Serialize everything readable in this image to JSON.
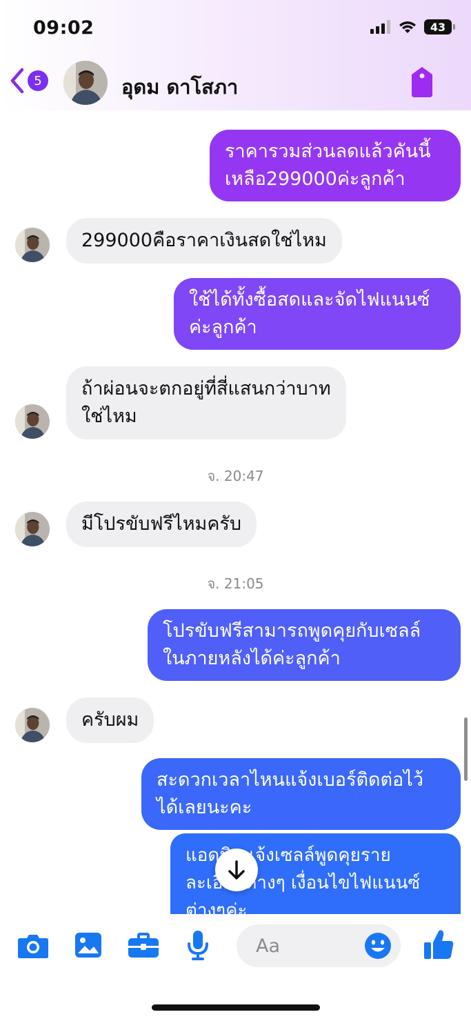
{
  "status_bar": {
    "time": "09:02",
    "battery": "43"
  },
  "header": {
    "unread_count": "5",
    "contact_name": "อุดม ดาโสภา"
  },
  "messages": [
    {
      "dir": "out",
      "text": "ราคารวมส่วนลดแล้วคันนี้\nเหลือ299000ค่ะลูกค้า"
    },
    {
      "dir": "in",
      "text": "299000คือราคาเงินสดใช่ไหม"
    },
    {
      "dir": "out",
      "text": "ใช้ได้ทั้งซื้อสดและจัดไฟแนนซ์\nค่ะลูกค้า"
    },
    {
      "dir": "in",
      "text": "ถ้าผ่อนจะตกอยู่ที่สี่แสนกว่าบาท\nใช่ไหม"
    },
    {
      "dir": "in",
      "text": "มีโปรขับฟรีไหมครับ"
    },
    {
      "dir": "out",
      "text": "โปรขับฟรีสามารถพูดคุยกับเซลล์\nในภายหลังได้ค่ะลูกค้า"
    },
    {
      "dir": "in",
      "text": "ครับผม"
    },
    {
      "dir": "out",
      "text": "สะดวกเวลาไหนแจ้งเบอร์ติดต่อไว้\nได้เลยนะคะ"
    },
    {
      "dir": "out",
      "text": "แอดมินแจ้งเซลล์พูดคุยราย\nละเอียดต่างๆ เงื่อนไขไฟแนนซ์\nต่างๆค่ะ"
    }
  ],
  "timestamps": [
    "จ. 20:47",
    "จ. 21:05"
  ],
  "composer": {
    "placeholder": "Aa"
  },
  "colors": {
    "bubble_gradient_top": "#9b3cf2",
    "bubble_gradient_bottom": "#2f6dfb",
    "incoming_bubble": "#efeff1",
    "icon_blue": "#1877f2",
    "badge_purple": "#7b2ff2"
  },
  "icons": [
    "back-chevron-icon",
    "tag-icon",
    "camera-icon",
    "image-icon",
    "toolbox-icon",
    "microphone-icon",
    "emoji-icon",
    "thumbs-up-icon",
    "arrow-down-icon"
  ]
}
